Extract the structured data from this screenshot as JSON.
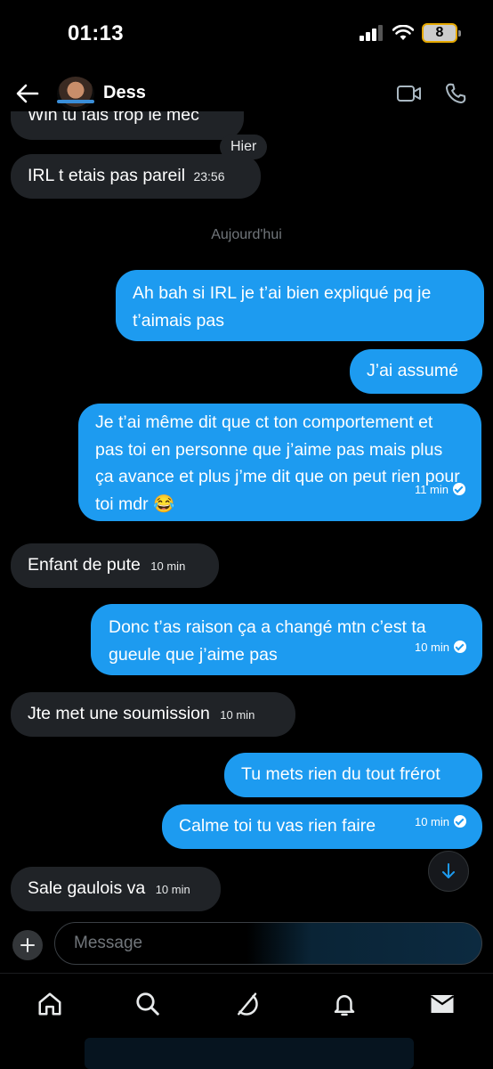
{
  "status_bar": {
    "time": "01:13",
    "battery": "8"
  },
  "header": {
    "contact_name": "Dess"
  },
  "messages": [
    {
      "dir": "in",
      "text": "Wlh tu fais trop le mec",
      "time": ""
    },
    {
      "dir": "in",
      "text": "IRL t etais pas pareil",
      "time": "23:56"
    },
    {
      "dir": "out",
      "text": "Ah bah si IRL je t’ai bien expliqué pq je t’aimais pas",
      "time": ""
    },
    {
      "dir": "out",
      "text": "J’ai assumé",
      "time": ""
    },
    {
      "dir": "out",
      "text": "Je t’ai même dit que ct ton comportement et pas toi en personne que j’aime pas mais plus ça avance et plus j’me dit que on peut rien pour toi mdr 😂",
      "time": "11 min"
    },
    {
      "dir": "in",
      "text": "Enfant de pute",
      "time": "10 min"
    },
    {
      "dir": "out",
      "text": "Donc t’as raison ça a changé mtn c’est ta gueule que j’aime pas",
      "time": "10 min"
    },
    {
      "dir": "in",
      "text": "Jte met une soumission",
      "time": "10 min"
    },
    {
      "dir": "out",
      "text": "Tu mets rien du tout frérot",
      "time": ""
    },
    {
      "dir": "out",
      "text": "Calme toi tu vas rien faire",
      "time": "10 min"
    },
    {
      "dir": "in",
      "text": "Sale gaulois va",
      "time": "10 min"
    }
  ],
  "hier_pill": "Hier",
  "day_separator": "Aujourd'hui",
  "composer": {
    "placeholder": "Message"
  },
  "nav": [
    "home-icon",
    "search-icon",
    "grok-icon",
    "notifications-icon",
    "messages-icon"
  ],
  "colors": {
    "accent": "#1d9bf0",
    "incoming_bubble": "#202327",
    "background": "#000000"
  }
}
